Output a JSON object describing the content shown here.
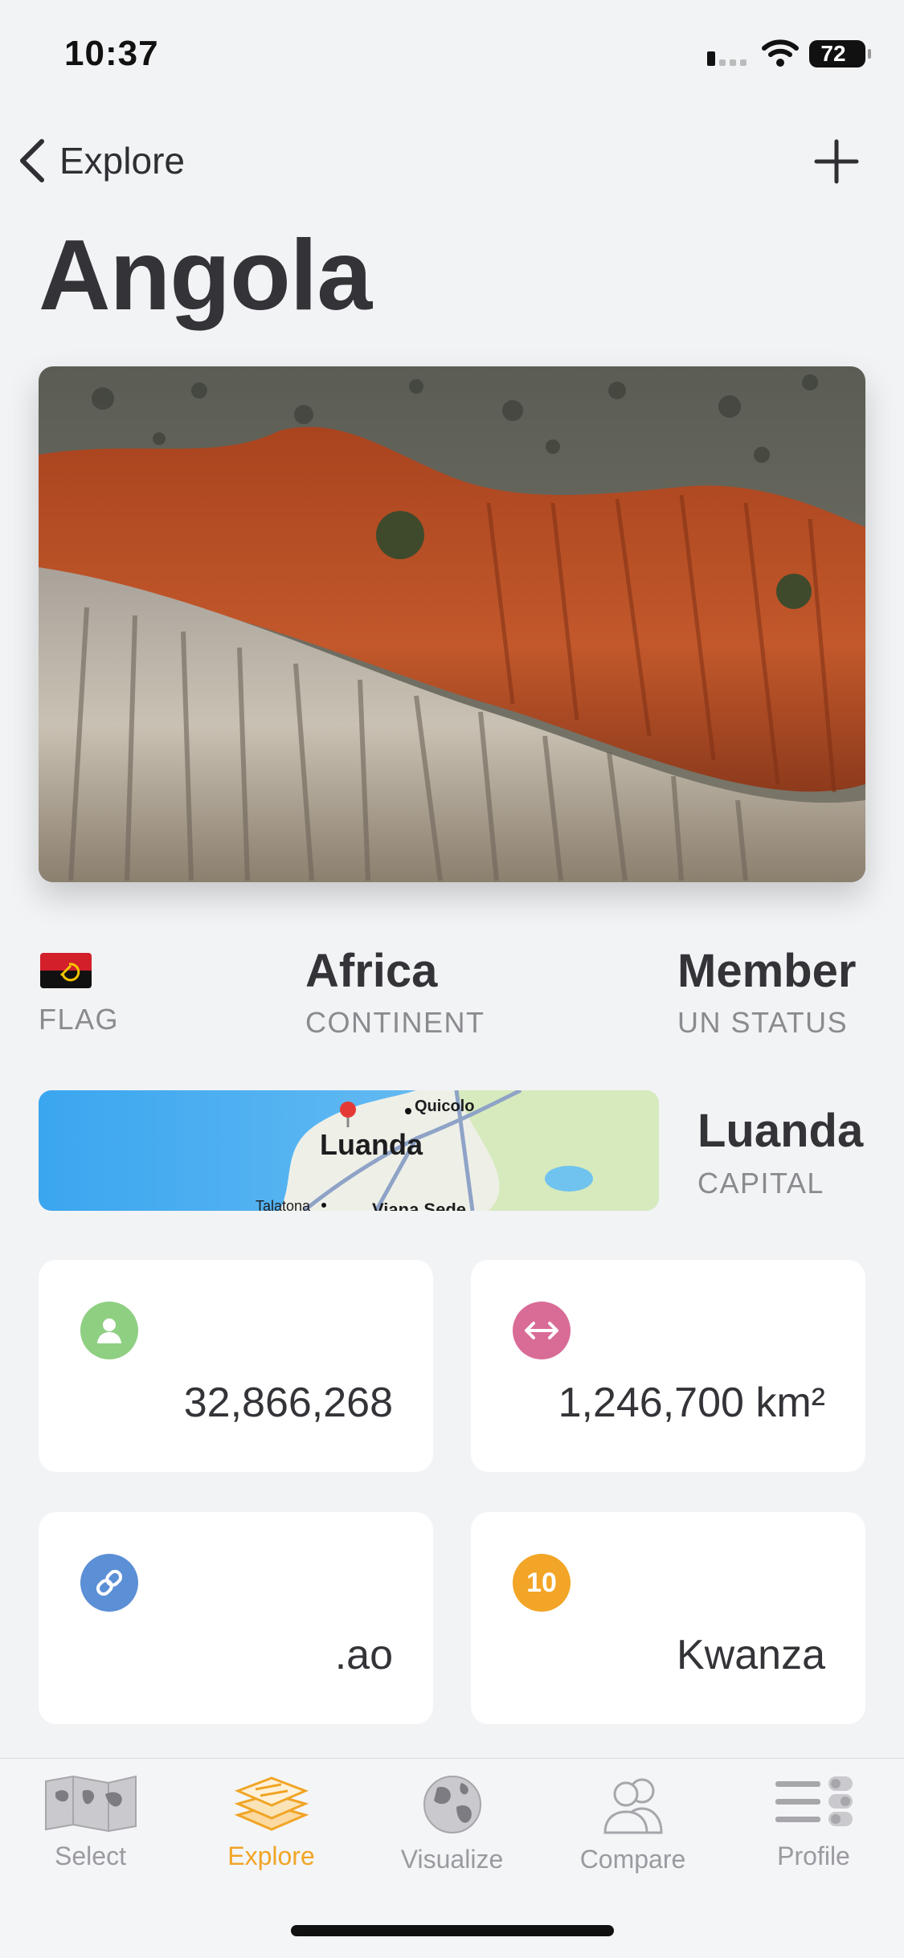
{
  "status_bar": {
    "time": "10:37",
    "battery": "72"
  },
  "nav": {
    "back_label": "Explore"
  },
  "country": {
    "name": "Angola",
    "continent": "Africa",
    "continent_label": "CONTINENT",
    "flag_label": "FLAG",
    "un_status": "Member",
    "un_status_label": "UN STATUS",
    "capital": "Luanda",
    "capital_label": "CAPITAL"
  },
  "map": {
    "labels": {
      "city": "Luanda",
      "north": "Quicolo",
      "south_left": "Talatona",
      "south_right": "Viana Sede"
    }
  },
  "stats": [
    {
      "icon": "person-icon",
      "value": "32,866,268",
      "color": "#8fcf82"
    },
    {
      "icon": "arrows-horizontal-icon",
      "value": "1,246,700 km²",
      "color": "#d96b97"
    },
    {
      "icon": "link-icon",
      "value": ".ao",
      "color": "#5b8fd6"
    },
    {
      "icon": "currency-icon",
      "badge": "10",
      "value": "Kwanza",
      "color": "#f2a526"
    }
  ],
  "tabs": [
    {
      "label": "Select",
      "icon": "world-map-icon"
    },
    {
      "label": "Explore",
      "icon": "layers-icon",
      "active": true
    },
    {
      "label": "Visualize",
      "icon": "globe-icon"
    },
    {
      "label": "Compare",
      "icon": "people-icon"
    },
    {
      "label": "Profile",
      "icon": "list-toggle-icon"
    }
  ],
  "colors": {
    "accent": "#f0a526",
    "background": "#f2f3f5"
  }
}
